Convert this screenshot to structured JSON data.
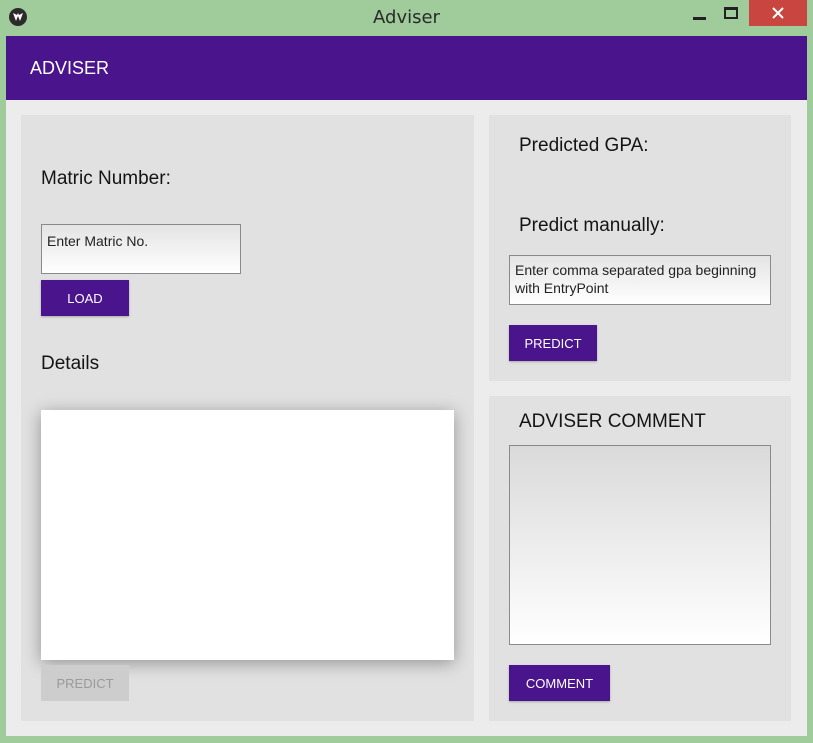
{
  "window": {
    "title": "Adviser",
    "icons": [
      "kivy-logo-icon",
      "minimize-icon",
      "maximize-icon",
      "close-icon"
    ]
  },
  "appbar": {
    "title": "ADVISER"
  },
  "left_panel": {
    "matric_label": "Matric Number:",
    "matric_input": {
      "value": "",
      "placeholder": "Enter Matric No."
    },
    "load_button": "LOAD",
    "details_label": "Details",
    "details_content": "",
    "predict_button": "PREDICT",
    "predict_button_disabled": true
  },
  "right_top_panel": {
    "predicted_gpa_label": "Predicted GPA:",
    "predicted_gpa_value": "",
    "manual_label": "Predict manually:",
    "gpa_input": {
      "value": "",
      "placeholder": "Enter comma separated gpa beginning with EntryPoint"
    },
    "predict_button": "PREDICT"
  },
  "right_bottom_panel": {
    "comment_label": "ADVISER COMMENT",
    "comment_text": "",
    "comment_button": "COMMENT"
  },
  "colors": {
    "accent": "#4a148c",
    "window_frame": "#9fcc9a",
    "close_button": "#c8463f",
    "card_background": "#e1e1e1",
    "disabled_button": "#cdcdcd"
  }
}
